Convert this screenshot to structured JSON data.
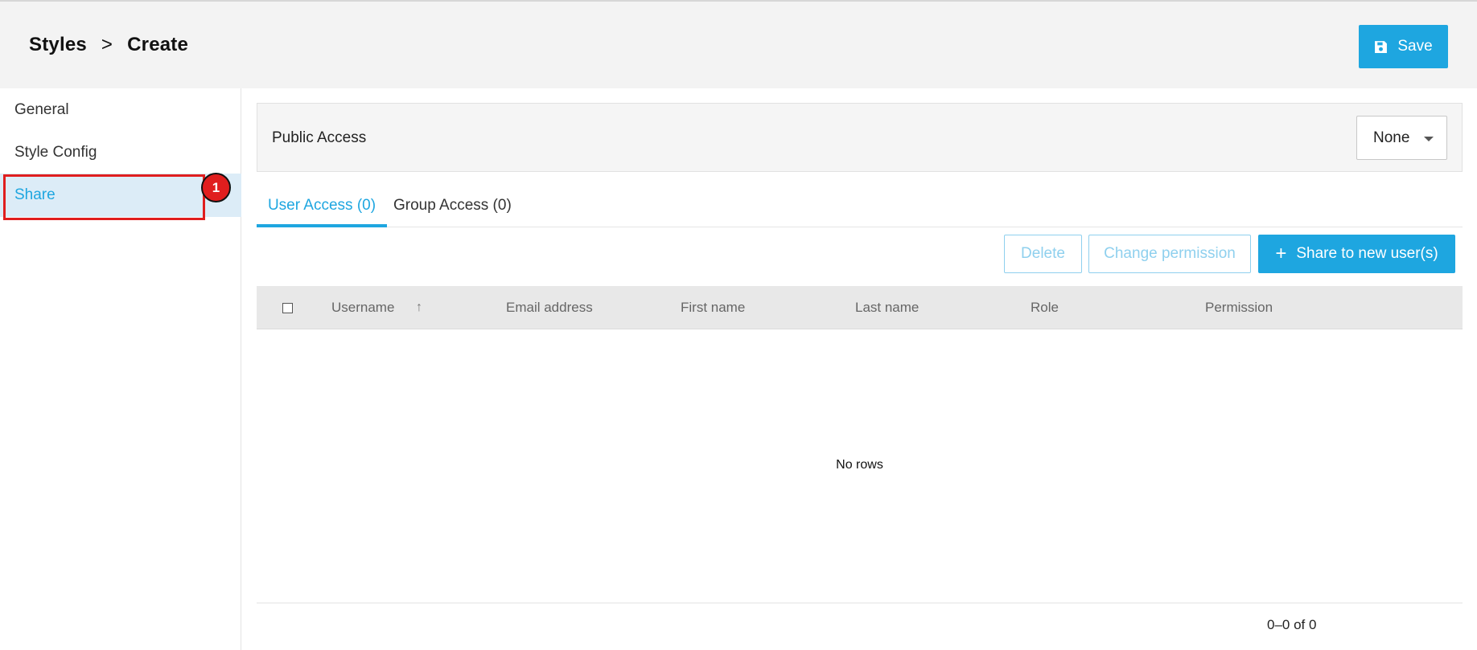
{
  "header": {
    "breadcrumb_root": "Styles",
    "breadcrumb_separator": ">",
    "breadcrumb_current": "Create",
    "save_label": "Save"
  },
  "sidebar": {
    "items": [
      {
        "label": "General",
        "active": false
      },
      {
        "label": "Style Config",
        "active": false
      },
      {
        "label": "Share",
        "active": true
      }
    ]
  },
  "annotation": {
    "badge": "1",
    "color": "#e01e1e"
  },
  "public_access": {
    "label": "Public Access",
    "selected": "None"
  },
  "tabs": [
    {
      "label": "User Access (0)",
      "active": true
    },
    {
      "label": "Group Access (0)",
      "active": false
    }
  ],
  "actions": {
    "delete_label": "Delete",
    "change_permission_label": "Change permission",
    "share_label": "Share to new user(s)",
    "share_icon": "plus-icon"
  },
  "table": {
    "columns": [
      "Username",
      "Email address",
      "First name",
      "Last name",
      "Role",
      "Permission"
    ],
    "sort_column": "Username",
    "sort_direction": "ascending",
    "empty_text": "No rows",
    "pagination": "0–0 of 0"
  },
  "colors": {
    "accent": "#1ea6e0",
    "active_bg": "#dcecf7",
    "header_bg": "#f3f3f3"
  }
}
